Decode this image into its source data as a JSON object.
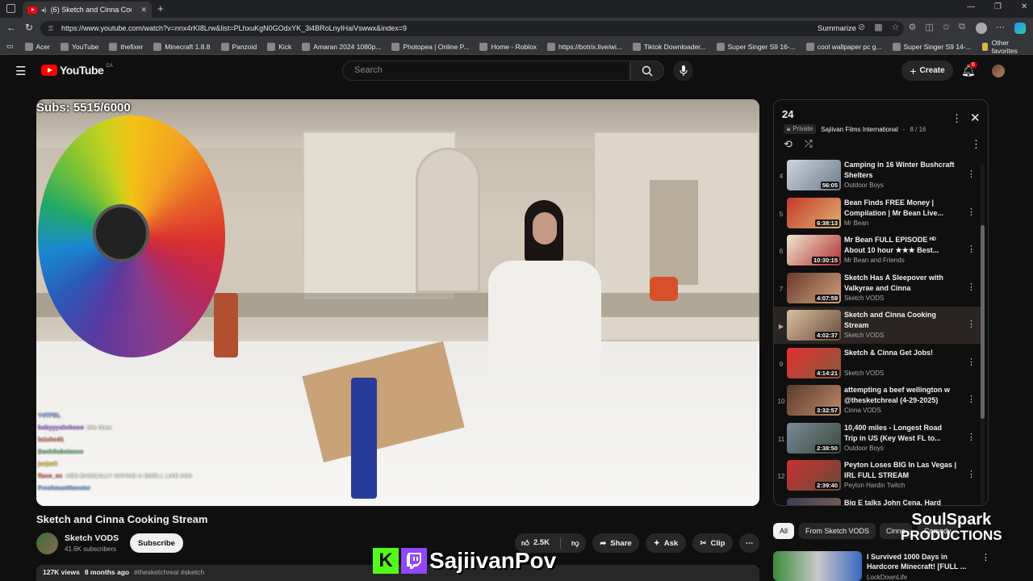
{
  "browser": {
    "tab_title": "(6) Sketch and Cinna Cookin...",
    "url": "https://www.youtube.com/watch?v=nnx4rKI8Lrw&list=PLhxuKgN0GOdxYK_3i4BRoLnyIHaiVswwx&index=9",
    "summarize_label": "Summarize",
    "bookmarks": [
      "Acer",
      "YouTube",
      "thefixer",
      "Minecraft 1.8.8",
      "Panzoid",
      "Kick",
      "Amaran 2024 1080p...",
      "Photopea | Online P...",
      "Home - Roblox",
      "https://botrix.live/wi...",
      "Tiktok Downloader...",
      "Super Singer S9 16-...",
      "cool wallpaper pc g...",
      "Super Singer S9 14-..."
    ],
    "other_favorites": "Other favorites"
  },
  "youtube": {
    "logo_text": "YouTube",
    "country": "CA",
    "search_placeholder": "Search",
    "create_label": "Create",
    "notif_count": "6"
  },
  "overlay": {
    "subs_text": "Subs: 5515/6000",
    "chat": [
      {
        "user": "Y4TFEL",
        "msg": ""
      },
      {
        "user": "babyyyukeboso",
        "msg": "she does"
      },
      {
        "user": "la1shed1",
        "msg": ""
      },
      {
        "user": "DankSubstance",
        "msg": ""
      },
      {
        "user": "jurjack",
        "msg": ""
      },
      {
        "user": "flaco_oc",
        "msg": "HES BASICALLY SAYING U SMELL LIKE ASS"
      },
      {
        "user": "FreshmanMonster",
        "msg": ""
      }
    ],
    "watermark_bottom": "SajiivanPov",
    "watermark_right_line1": "SoulSpark",
    "watermark_right_line2": "PRODUCTIONS"
  },
  "video_meta": {
    "title": "Sketch and Cinna Cooking Stream",
    "channel": "Sketch VODS",
    "subscribers": "41.6K subscribers",
    "subscribe_label": "Subscribe",
    "likes": "2.5K",
    "share_label": "Share",
    "ask_label": "Ask",
    "clip_label": "Clip",
    "views": "127K views",
    "age": "8 months ago",
    "tags": "#thesketchreal #sketch"
  },
  "playlist": {
    "title": "24",
    "privacy": "Private",
    "owner": "Sajiivan Films International",
    "position": "8 / 16",
    "items": [
      {
        "index": "4",
        "title": "Camping in 16 Winter Bushcraft Shelters",
        "channel": "Outdoor Boys",
        "duration": "56:05",
        "thumb": [
          "#cfd6de",
          "#6a7a8a"
        ]
      },
      {
        "index": "5",
        "title": "Bean Finds FREE Money | Compilation | Mr Bean Live...",
        "channel": "Mr Bean",
        "duration": "6:38:13",
        "thumb": [
          "#c43a2a",
          "#e0b070"
        ]
      },
      {
        "index": "6",
        "title": "Mr Bean FULL EPISODE ᴴᴰ About 10 hour ★★★ Best...",
        "channel": "Mr Bean and Friends",
        "duration": "10:30:15",
        "thumb": [
          "#f0e8d0",
          "#b03030"
        ]
      },
      {
        "index": "7",
        "title": "Sketch Has A Sleepover with Valkyrae and Cinna",
        "channel": "Sketch VODS",
        "duration": "4:07:59",
        "thumb": [
          "#6a3a2a",
          "#d0a080"
        ]
      },
      {
        "index": "▶",
        "title": "Sketch and Cinna Cooking Stream",
        "channel": "Sketch VODS",
        "duration": "4:02:37",
        "thumb": [
          "#d8c0a0",
          "#6a4a3a"
        ],
        "active": true
      },
      {
        "index": "9",
        "title": "Sketch & Cinna Get Jobs!",
        "channel": "Sketch VODS",
        "duration": "4:14:21",
        "thumb": [
          "#e03030",
          "#8a5a3a"
        ]
      },
      {
        "index": "10",
        "title": "attempting a beef wellington w @thesketchreal (4-29-2025)",
        "channel": "Cinna VODS",
        "duration": "3:32:57",
        "thumb": [
          "#5a3a2a",
          "#c08a6a"
        ]
      },
      {
        "index": "11",
        "title": "10,400 miles - Longest Road Trip in US (Key West FL to...",
        "channel": "Outdoor Boys",
        "duration": "2:38:50",
        "thumb": [
          "#7a8a9a",
          "#3a4a3a"
        ]
      },
      {
        "index": "12",
        "title": "Peyton Loses BIG In Las Vegas | IRL FULL STREAM",
        "channel": "Peyton Hardin Twitch",
        "duration": "2:39:40",
        "thumb": [
          "#c83030",
          "#6a4a3a"
        ]
      },
      {
        "index": "",
        "title": "Big E talks John Cena, Hard",
        "channel": "",
        "duration": "",
        "thumb": [
          "#3a3a5a",
          "#8a6a4a"
        ]
      }
    ]
  },
  "chips": [
    "All",
    "From Sketch VODS",
    "Cinna",
    "Comedy"
  ],
  "recommended": {
    "title": "I Survived 1000 Days in Hardcore Minecraft! [FULL ...",
    "channel": "LockDownLife"
  },
  "colors": {
    "yt_red": "#ff0000",
    "bg": "#0f0f0f",
    "twitch_purple": "#9146ff",
    "kick_green": "#53fc18"
  }
}
